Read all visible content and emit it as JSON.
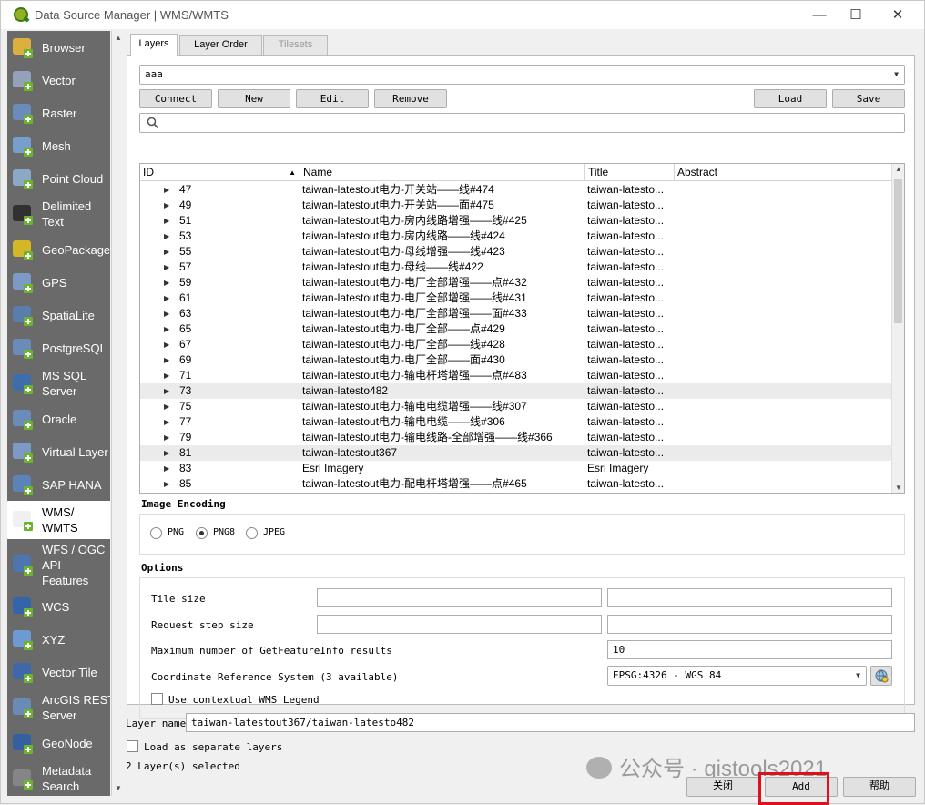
{
  "window": {
    "title": "Data Source Manager | WMS/WMTS"
  },
  "sidebar": {
    "items": [
      {
        "label": "Browser",
        "icon": "folder-icon"
      },
      {
        "label": "Vector",
        "icon": "vector-layer-icon"
      },
      {
        "label": "Raster",
        "icon": "raster-layer-icon"
      },
      {
        "label": "Mesh",
        "icon": "mesh-layer-icon"
      },
      {
        "label": "Point Cloud",
        "icon": "point-cloud-icon"
      },
      {
        "label": "Delimited\nText",
        "icon": "delimited-text-icon"
      },
      {
        "label": "GeoPackage",
        "icon": "geopackage-icon"
      },
      {
        "label": "GPS",
        "icon": "gps-icon"
      },
      {
        "label": "SpatiaLite",
        "icon": "spatialite-icon"
      },
      {
        "label": "PostgreSQL",
        "icon": "postgresql-icon"
      },
      {
        "label": "MS SQL\nServer",
        "icon": "mssql-icon"
      },
      {
        "label": "Oracle",
        "icon": "oracle-icon"
      },
      {
        "label": "Virtual Layer",
        "icon": "virtual-layer-icon"
      },
      {
        "label": "SAP HANA",
        "icon": "sap-hana-icon"
      },
      {
        "label": "WMS/\nWMTS",
        "icon": "wms-globe-icon"
      },
      {
        "label": "WFS / OGC\nAPI -\nFeatures",
        "icon": "wfs-icon"
      },
      {
        "label": "WCS",
        "icon": "wcs-globe-icon"
      },
      {
        "label": "XYZ",
        "icon": "xyz-grid-icon"
      },
      {
        "label": "Vector Tile",
        "icon": "vector-tile-icon"
      },
      {
        "label": "ArcGIS REST\nServer",
        "icon": "arcgis-rest-icon"
      },
      {
        "label": "GeoNode",
        "icon": "geonode-icon"
      },
      {
        "label": "Metadata\nSearch",
        "icon": "metadata-search-icon"
      }
    ],
    "selected": "WMS/\nWMTS"
  },
  "tabs": [
    {
      "label": "Layers",
      "state": "active"
    },
    {
      "label": "Layer Order",
      "state": "normal"
    },
    {
      "label": "Tilesets",
      "state": "disabled"
    }
  ],
  "connection": {
    "selected": "aaa",
    "buttons": {
      "connect": "Connect",
      "new": "New",
      "edit": "Edit",
      "remove": "Remove",
      "load": "Load",
      "save": "Save"
    }
  },
  "search": {
    "placeholder": ""
  },
  "table": {
    "columns": [
      "ID",
      "Name",
      "Title",
      "Abstract"
    ],
    "rows": [
      {
        "id": "47",
        "name": "taiwan-latestout电力-开关站——线#474",
        "title": "taiwan-latesto...",
        "selected": false
      },
      {
        "id": "49",
        "name": "taiwan-latestout电力-开关站——面#475",
        "title": "taiwan-latesto...",
        "selected": false
      },
      {
        "id": "51",
        "name": "taiwan-latestout电力-房内线路增强——线#425",
        "title": "taiwan-latesto...",
        "selected": false
      },
      {
        "id": "53",
        "name": "taiwan-latestout电力-房内线路——线#424",
        "title": "taiwan-latesto...",
        "selected": false
      },
      {
        "id": "55",
        "name": "taiwan-latestout电力-母线增强——线#423",
        "title": "taiwan-latesto...",
        "selected": false
      },
      {
        "id": "57",
        "name": "taiwan-latestout电力-母线——线#422",
        "title": "taiwan-latesto...",
        "selected": false
      },
      {
        "id": "59",
        "name": "taiwan-latestout电力-电厂全部增强——点#432",
        "title": "taiwan-latesto...",
        "selected": false
      },
      {
        "id": "61",
        "name": "taiwan-latestout电力-电厂全部增强——线#431",
        "title": "taiwan-latesto...",
        "selected": false
      },
      {
        "id": "63",
        "name": "taiwan-latestout电力-电厂全部增强——面#433",
        "title": "taiwan-latesto...",
        "selected": false
      },
      {
        "id": "65",
        "name": "taiwan-latestout电力-电厂全部——点#429",
        "title": "taiwan-latesto...",
        "selected": false
      },
      {
        "id": "67",
        "name": "taiwan-latestout电力-电厂全部——线#428",
        "title": "taiwan-latesto...",
        "selected": false
      },
      {
        "id": "69",
        "name": "taiwan-latestout电力-电厂全部——面#430",
        "title": "taiwan-latesto...",
        "selected": false
      },
      {
        "id": "71",
        "name": "taiwan-latestout电力-输电杆塔增强——点#483",
        "title": "taiwan-latesto...",
        "selected": false
      },
      {
        "id": "73",
        "name": "taiwan-latesto482",
        "title": "taiwan-latesto...",
        "selected": true
      },
      {
        "id": "75",
        "name": "taiwan-latestout电力-输电电缆增强——线#307",
        "title": "taiwan-latesto...",
        "selected": false
      },
      {
        "id": "77",
        "name": "taiwan-latestout电力-输电电缆——线#306",
        "title": "taiwan-latesto...",
        "selected": false
      },
      {
        "id": "79",
        "name": "taiwan-latestout电力-输电线路-全部增强——线#366",
        "title": "taiwan-latesto...",
        "selected": false
      },
      {
        "id": "81",
        "name": "taiwan-latestout367",
        "title": "taiwan-latesto...",
        "selected": true
      },
      {
        "id": "83",
        "name": "Esri Imagery",
        "title": "Esri Imagery",
        "selected": false
      },
      {
        "id": "85",
        "name": "taiwan-latestout电力-配电杆塔增强——点#465",
        "title": "taiwan-latesto...",
        "selected": false
      }
    ]
  },
  "image_encoding": {
    "label": "Image Encoding",
    "options": [
      {
        "label": "PNG",
        "checked": false
      },
      {
        "label": "PNG8",
        "checked": true
      },
      {
        "label": "JPEG",
        "checked": false
      }
    ]
  },
  "options": {
    "label": "Options",
    "tile_size_label": "Tile size",
    "request_step_label": "Request step size",
    "max_feature_label": "Maximum number of GetFeatureInfo results",
    "max_feature_value": "10",
    "crs_label": "Coordinate Reference System (3 available)",
    "crs_value": "EPSG:4326 - WGS 84",
    "contextual_legend_label": "Use contextual WMS Legend"
  },
  "bottom": {
    "layer_name_label": "Layer name",
    "layer_name_value": "taiwan-latestout367/taiwan-latesto482",
    "separate_layers_label": "Load as separate layers",
    "selected_count": "2 Layer(s) selected",
    "close_label": "关闭",
    "add_label": "Add",
    "help_label": "帮助"
  },
  "watermark": {
    "text": "公众号 · gistools2021"
  },
  "colors": {
    "sidebar_bg": "#6a6a6a",
    "highlight_border": "#e0101a",
    "selected_row": "#ebebeb"
  }
}
